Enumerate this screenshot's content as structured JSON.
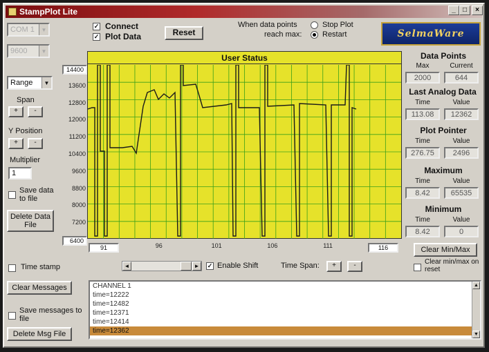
{
  "window": {
    "title": "StampPlot Lite"
  },
  "titlebar_buttons": [
    "_",
    "□",
    "×"
  ],
  "port": {
    "com": "COM 1",
    "baud": "9600"
  },
  "checks": {
    "connect": "Connect",
    "plot_data": "Plot Data"
  },
  "reset_label": "Reset",
  "max_action": {
    "label_line1": "When data points",
    "label_line2": "reach max:",
    "stop": "Stop Plot",
    "restart": "Restart",
    "selected": "restart"
  },
  "logo_text": "SelmaWare",
  "left": {
    "mode": "Range",
    "span_label": "Span",
    "ypos_label": "Y Position",
    "multiplier_label": "Multiplier",
    "multiplier_value": "1",
    "save_data_label": "Save data to file",
    "delete_data_label": "Delete Data File",
    "timestamp_label": "Time stamp",
    "clear_messages_label": "Clear Messages",
    "save_messages_label": "Save messages to file",
    "delete_msg_label": "Delete Msg File"
  },
  "plot": {
    "title": "User Status",
    "y_max": "14400",
    "y_min": "6400",
    "y_ticks": [
      "13600",
      "12800",
      "12000",
      "11200",
      "10400",
      "9600",
      "8800",
      "8000",
      "7200"
    ],
    "x_start": "91",
    "x_end": "116",
    "x_ticks": [
      "96",
      "101",
      "106",
      "111"
    ],
    "background": "#e6e22a",
    "grid_color": "#3aa01a",
    "trace_color": "#1a1a1a"
  },
  "controls": {
    "enable_shift_label": "Enable Shift",
    "time_span_label": "Time Span:",
    "minus": "-",
    "plus": "+"
  },
  "right": {
    "data_points": {
      "title": "Data Points",
      "max_label": "Max",
      "current_label": "Current",
      "max": "2000",
      "current": "644"
    },
    "last_analog": {
      "title": "Last Analog Data",
      "time_label": "Time",
      "value_label": "Value",
      "time": "113.08",
      "value": "12362"
    },
    "plot_pointer": {
      "title": "Plot Pointer",
      "time_label": "Time",
      "value_label": "Value",
      "time": "276.75",
      "value": "2496"
    },
    "maximum": {
      "title": "Maximum",
      "time_label": "Time",
      "value_label": "Value",
      "time": "8.42",
      "value": "65535"
    },
    "minimum": {
      "title": "Minimum",
      "time_label": "Time",
      "value_label": "Value",
      "time": "8.42",
      "value": "0"
    },
    "clear_minmax_label": "Clear Min/Max",
    "clear_on_reset_label": "Clear min/max on reset"
  },
  "messages": [
    "CHANNEL 1",
    "time=12222",
    "time=12482",
    "time=12371",
    "time=12414",
    "time=12362"
  ]
}
